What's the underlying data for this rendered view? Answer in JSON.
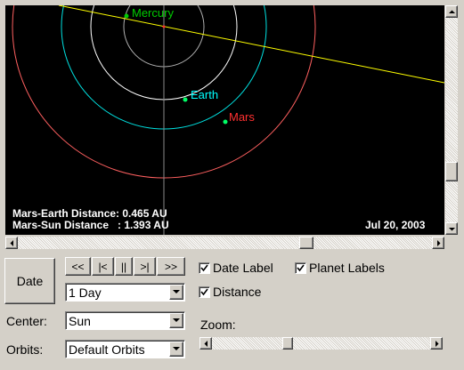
{
  "canvas": {
    "background": "#000000",
    "planets": {
      "mercury": {
        "label": "Mercury",
        "color": "#00cc00"
      },
      "earth": {
        "label": "Earth",
        "color": "#00ffff"
      },
      "mars": {
        "label": "Mars",
        "color": "#ff3030"
      }
    },
    "orbit_colors": {
      "mercury": "#b0b0b0",
      "venus": "#ffffff",
      "earth": "#00e0e0",
      "mars": "#ff6060"
    },
    "line_color": "#ffff00",
    "mars_earth_distance": "Mars-Earth Distance: 0.465 AU",
    "mars_sun_distance": "Mars-Sun Distance   : 1.393 AU",
    "date": "Jul 20, 2003"
  },
  "controls": {
    "date_button": "Date",
    "nav": {
      "fast_back": "<<",
      "step_back": "|<",
      "pause": "||",
      "step_forward": ">|",
      "fast_forward": ">>"
    },
    "step": {
      "selected": "1 Day"
    },
    "center": {
      "label": "Center:",
      "selected": "Sun"
    },
    "orbits": {
      "label": "Orbits:",
      "selected": "Default Orbits"
    },
    "checkboxes": {
      "date_label": {
        "label": "Date Label",
        "checked": true
      },
      "planet_labels": {
        "label": "Planet Labels",
        "checked": true
      },
      "distance": {
        "label": "Distance",
        "checked": true
      }
    },
    "zoom": {
      "label": "Zoom:",
      "value": 0.37
    }
  },
  "scrollbars": {
    "vertical_position": 0.72,
    "horizontal_position": 0.7
  }
}
